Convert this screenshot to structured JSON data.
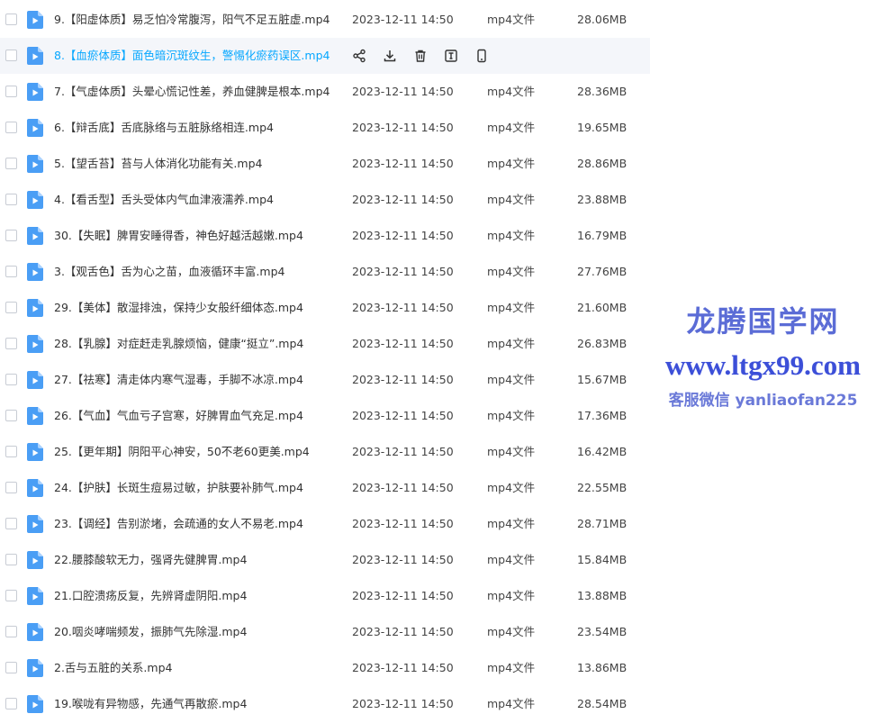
{
  "columns": {
    "type_label": "mp4文件"
  },
  "files": [
    {
      "name": "9.【阳虚体质】易乏怕冷常腹泻，阳气不足五脏虚.mp4",
      "date": "2023-12-11 14:50",
      "type": "mp4文件",
      "size": "28.06MB"
    },
    {
      "name": "8.【血瘀体质】面色暗沉斑纹生，警惕化瘀药误区.mp4",
      "date": "",
      "type": "",
      "size": "",
      "hovered": true
    },
    {
      "name": "7.【气虚体质】头晕心慌记性差，养血健脾是根本.mp4",
      "date": "2023-12-11 14:50",
      "type": "mp4文件",
      "size": "28.36MB"
    },
    {
      "name": "6.【辩舌底】舌底脉络与五脏脉络相连.mp4",
      "date": "2023-12-11 14:50",
      "type": "mp4文件",
      "size": "19.65MB"
    },
    {
      "name": "5.【望舌苔】苔与人体消化功能有关.mp4",
      "date": "2023-12-11 14:50",
      "type": "mp4文件",
      "size": "28.86MB"
    },
    {
      "name": "4.【看舌型】舌头受体内气血津液濡养.mp4",
      "date": "2023-12-11 14:50",
      "type": "mp4文件",
      "size": "23.88MB"
    },
    {
      "name": "30.【失眠】脾胃安睡得香，神色好越活越嫩.mp4",
      "date": "2023-12-11 14:50",
      "type": "mp4文件",
      "size": "16.79MB"
    },
    {
      "name": "3.【观舌色】舌为心之苗，血液循环丰富.mp4",
      "date": "2023-12-11 14:50",
      "type": "mp4文件",
      "size": "27.76MB"
    },
    {
      "name": "29.【美体】散湿排浊，保持少女般纤细体态.mp4",
      "date": "2023-12-11 14:50",
      "type": "mp4文件",
      "size": "21.60MB"
    },
    {
      "name": "28.【乳腺】对症赶走乳腺烦恼，健康“挺立”.mp4",
      "date": "2023-12-11 14:50",
      "type": "mp4文件",
      "size": "26.83MB"
    },
    {
      "name": "27.【祛寒】清走体内寒气湿毒，手脚不冰凉.mp4",
      "date": "2023-12-11 14:50",
      "type": "mp4文件",
      "size": "15.67MB"
    },
    {
      "name": "26.【气血】气血亏子宫寒，好脾胃血气充足.mp4",
      "date": "2023-12-11 14:50",
      "type": "mp4文件",
      "size": "17.36MB"
    },
    {
      "name": "25.【更年期】阴阳平心神安，50不老60更美.mp4",
      "date": "2023-12-11 14:50",
      "type": "mp4文件",
      "size": "16.42MB"
    },
    {
      "name": "24.【护肤】长斑生痘易过敏，护肤要补肺气.mp4",
      "date": "2023-12-11 14:50",
      "type": "mp4文件",
      "size": "22.55MB"
    },
    {
      "name": "23.【调经】告别淤堵，会疏通的女人不易老.mp4",
      "date": "2023-12-11 14:50",
      "type": "mp4文件",
      "size": "28.71MB"
    },
    {
      "name": "22.腰膝酸软无力，强肾先健脾胃.mp4",
      "date": "2023-12-11 14:50",
      "type": "mp4文件",
      "size": "15.84MB"
    },
    {
      "name": "21.口腔溃疡反复，先辨肾虚阴阳.mp4",
      "date": "2023-12-11 14:50",
      "type": "mp4文件",
      "size": "13.88MB"
    },
    {
      "name": "20.咽炎哮喘频发，振肺气先除湿.mp4",
      "date": "2023-12-11 14:50",
      "type": "mp4文件",
      "size": "23.54MB"
    },
    {
      "name": "2.舌与五脏的关系.mp4",
      "date": "2023-12-11 14:50",
      "type": "mp4文件",
      "size": "13.86MB"
    },
    {
      "name": "19.喉咙有异物感，先通气再散瘀.mp4",
      "date": "2023-12-11 14:50",
      "type": "mp4文件",
      "size": "28.54MB"
    }
  ],
  "hover_actions": [
    "share-icon",
    "download-icon",
    "delete-icon",
    "rename-icon",
    "phone-icon"
  ],
  "watermark": {
    "title": "龙腾国学网",
    "url": "www.ltgx99.com",
    "contact": "客服微信 yanliaofan225"
  },
  "colors": {
    "accent": "#06a7ff",
    "file_icon": "#4a9ef5",
    "hover_bg": "#f4f6fa",
    "watermark": "#3c4fd8"
  }
}
